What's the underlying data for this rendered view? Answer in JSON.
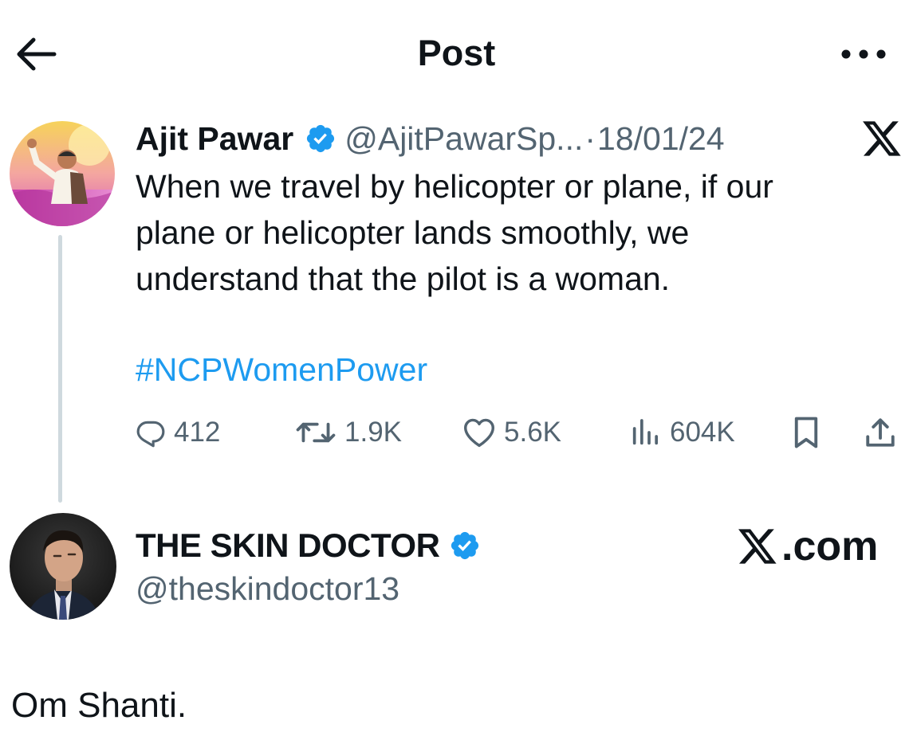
{
  "header": {
    "title": "Post",
    "back_icon": "arrow-left-icon",
    "more_icon": "more-horizontal-icon"
  },
  "quoted_post": {
    "author": {
      "name": "Ajit Pawar",
      "handle": "@AjitPawarSp...",
      "verified": true,
      "avatar": "avatar-ajit-pawar"
    },
    "separator": "·",
    "date": "18/01/24",
    "platform_icon": "x-logo-icon",
    "text": "When we travel by helicopter or plane, if our\nplane or helicopter lands smoothly, we\nunderstand that the pilot is a woman.",
    "hashtag": "#NCPWomenPower",
    "stats": {
      "replies": "412",
      "reposts": "1.9K",
      "likes": "5.6K",
      "views": "604K"
    }
  },
  "responder": {
    "name": "THE SKIN DOCTOR",
    "handle": "@theskindoctor13",
    "verified": true,
    "avatar": "avatar-skin-doctor",
    "watermark": ".com"
  },
  "reply": {
    "text": "Om Shanti."
  },
  "colors": {
    "text": "#0f1419",
    "secondary": "#536471",
    "link": "#1d9bf0",
    "verified": "#1d9bf0",
    "thread_line": "#cfd9de"
  }
}
